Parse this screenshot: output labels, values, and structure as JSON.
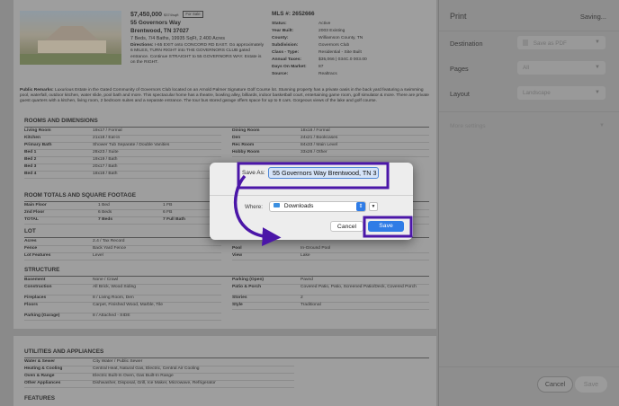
{
  "listing": {
    "price": "$7,450,000",
    "price_per_sqft": "$374/sqft",
    "status": "For Sale",
    "address_line1": "55 Governors Way",
    "address_line2": "Brentwood, TN 37027",
    "beds_baths": "7 Beds, 7/4 Baths, 19935 SqFt, 2.400 Acres",
    "directions_label": "Directions:",
    "directions": "I-65 EXIT onto CONCORD RD EAST. Go approximately 6 MILES, TURN RIGHT into THE GOVERNORS CLUB gated entrance. Continue STRAIGHT to 55 GOVERNORS WAY. Estate is on the RIGHT.",
    "mls_title": "MLS #: 2652666",
    "details": [
      {
        "k": "Status:",
        "v": "Active"
      },
      {
        "k": "Year Built:",
        "v": "2003 Existing"
      },
      {
        "k": "County:",
        "v": "Williamson County, TN"
      },
      {
        "k": "Subdivision:",
        "v": "Governors Club"
      },
      {
        "k": "Class - Type:",
        "v": "Residential - Site Built"
      },
      {
        "k": "Annual Taxes:",
        "v": "$35,066 | 034C.0 003.00"
      },
      {
        "k": "Days On Market:",
        "v": "87"
      },
      {
        "k": "Source:",
        "v": "Realtracs"
      }
    ],
    "remarks_label": "Public Remarks:",
    "remarks": "Luxurious Estate in the Gated Community of Governors Club located on an Arnold Palmer Signature Golf Course lot. Stunning property has a private oasis in the back yard featuring a swimming pool, waterfall, outdoor kitchen, water slide, pool bath and more. This spectacular home has a theatre, bowling alley, billiards, indoor basketball court, entertaining game room, golf simulator & more. There are private guest quarters with a kitchen, living room, 2 bedroom suites and a separate entrance. The tour bus stored garage offers space for up to 8 cars. Gorgeous views of the lake and golf course."
  },
  "rooms": {
    "title": "ROOMS AND DIMENSIONS",
    "left": [
      {
        "k": "Living Room",
        "v": "19x17 / Formal"
      },
      {
        "k": "Kitchen",
        "v": "21x18 / Eat-in"
      },
      {
        "k": "Primary Bath",
        "v": "Shower Tub Separate / Double Vanities"
      },
      {
        "k": "Bed 1",
        "v": "28x23 / Suite"
      },
      {
        "k": "Bed 2",
        "v": "19x19 / Bath"
      },
      {
        "k": "Bed 3",
        "v": "20x17 / Bath"
      },
      {
        "k": "Bed 4",
        "v": "18x18 / Bath"
      }
    ],
    "right": [
      {
        "k": "Dining Room",
        "v": "18x18 / Formal"
      },
      {
        "k": "Den",
        "v": "24x21 / Bookcases"
      },
      {
        "k": "Rec Room",
        "v": "84x33 / Main Level"
      },
      {
        "k": "Hobby Room",
        "v": "33x26 / Other"
      }
    ]
  },
  "totals": {
    "title": "ROOM TOTALS AND SQUARE FOOTAGE",
    "rows": [
      {
        "label": "Main Floor",
        "a": "1 Bed",
        "b": "1 FB"
      },
      {
        "label": "2nd Floor",
        "a": "6 Beds",
        "b": "6 FB"
      },
      {
        "label": "TOTAL",
        "a": "7 Beds",
        "b": "7 Full Bath"
      }
    ]
  },
  "lot": {
    "title": "LOT",
    "left": [
      {
        "k": "Acres",
        "v": "2.4 / Tax Record"
      },
      {
        "k": "Fence",
        "v": "Back Yard Fence"
      },
      {
        "k": "Lot Features",
        "v": "Level"
      }
    ],
    "right": [
      {
        "k": "Pool",
        "v": "In-Ground Pool"
      },
      {
        "k": "View",
        "v": "Lake"
      }
    ]
  },
  "structure": {
    "title": "STRUCTURE",
    "left": [
      {
        "k": "Basement",
        "v": "None / Crawl"
      },
      {
        "k": "Construction",
        "v": "All Brick, Wood Siding"
      },
      {
        "k": "Fireplaces",
        "v": "8 / Living Room, Den"
      },
      {
        "k": "Floors",
        "v": "Carpet, Finished Wood, Marble, Tile"
      },
      {
        "k": "Parking (Garage)",
        "v": "8 / Attached - SIDE"
      }
    ],
    "right": [
      {
        "k": "Parking (Open)",
        "v": "Paved"
      },
      {
        "k": "Patio & Porch",
        "v": "Covered Patio, Patio, Screened Patio/Deck, Covered Porch"
      },
      {
        "k": "Stories",
        "v": "2"
      },
      {
        "k": "Style",
        "v": "Traditional"
      }
    ]
  },
  "utilities": {
    "title": "UTILITIES AND APPLIANCES",
    "rows": [
      {
        "k": "Water & Sewer",
        "v": "City Water / Public Sewer"
      },
      {
        "k": "Heating & Cooling",
        "v": "Central Heat, Natural Gas, Electric, Central Air Cooling"
      },
      {
        "k": "Oven & Range",
        "v": "Electric Built-In Oven, Gas Built-In Range"
      },
      {
        "k": "Other Appliances",
        "v": "Dishwasher, Disposal, Grill, Ice Maker, Microwave, Refrigerator"
      }
    ]
  },
  "features": {
    "title": "FEATURES"
  },
  "print_panel": {
    "title": "Print",
    "status": "Saving...",
    "destination_label": "Destination",
    "destination_value": "Save as PDF",
    "pages_label": "Pages",
    "pages_value": "All",
    "layout_label": "Layout",
    "layout_value": "Landscape",
    "more_settings": "More settings",
    "cancel": "Cancel",
    "save": "Save"
  },
  "save_dialog": {
    "save_as_label": "Save As:",
    "filename": "55 Governors Way Brentwood, TN 3",
    "where_label": "Where:",
    "where_value": "Downloads",
    "cancel": "Cancel",
    "save": "Save"
  },
  "colors": {
    "annotation": "#4b16a8",
    "accent": "#2f7ce6"
  }
}
